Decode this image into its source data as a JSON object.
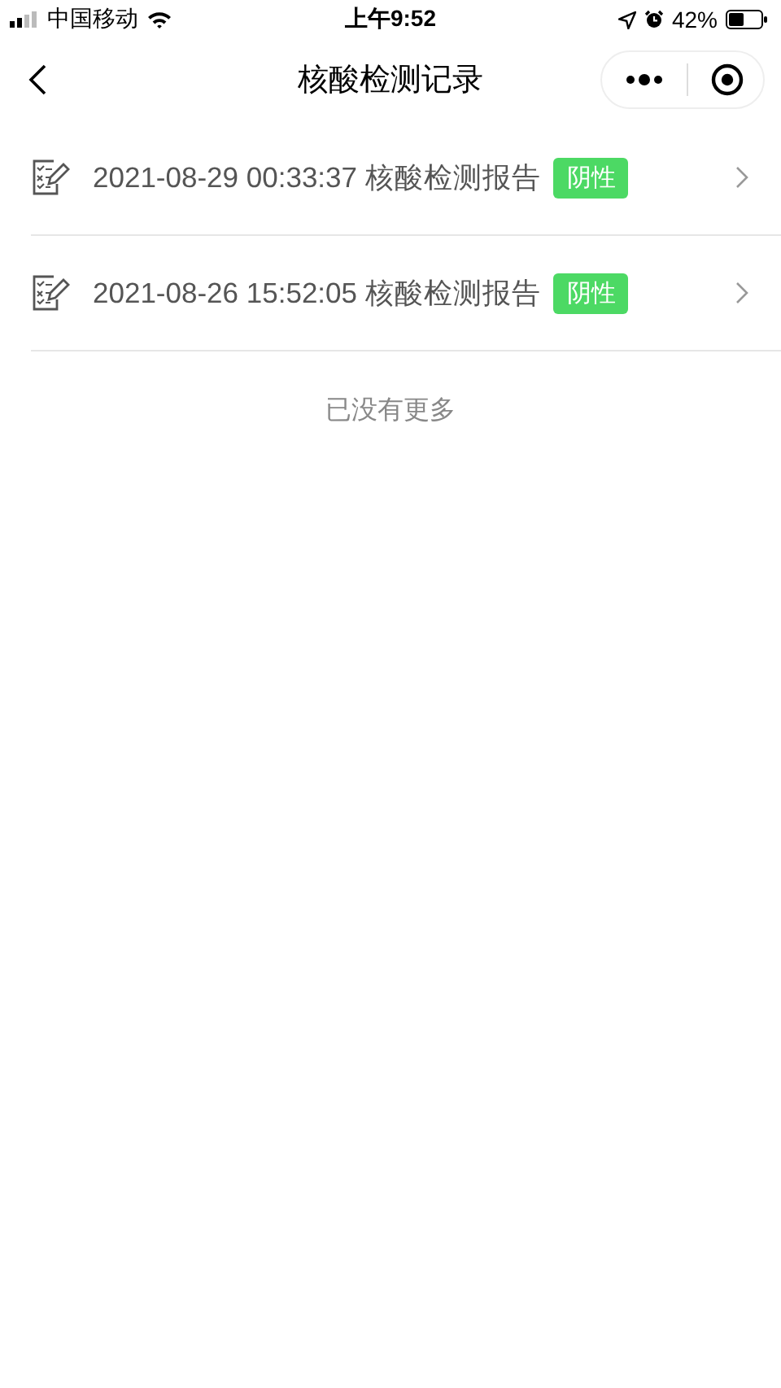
{
  "status_bar": {
    "carrier": "中国移动",
    "time": "上午9:52",
    "battery": "42%"
  },
  "nav": {
    "title": "核酸检测记录"
  },
  "records": [
    {
      "text": "2021-08-29 00:33:37 核酸检测报告",
      "tag": "阴性",
      "color": "#4cd964"
    },
    {
      "text": "2021-08-26 15:52:05 核酸检测报告",
      "tag": "阴性",
      "color": "#4cd964"
    }
  ],
  "footer": "已没有更多"
}
